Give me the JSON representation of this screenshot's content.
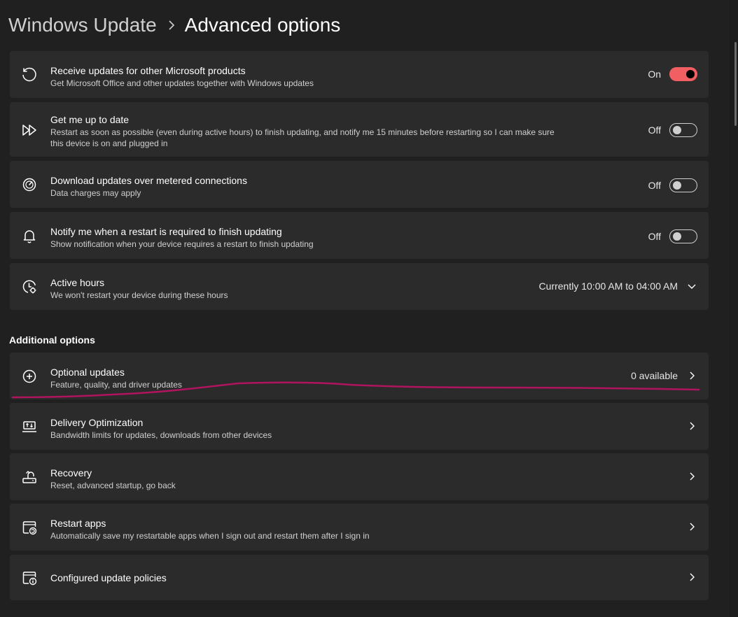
{
  "breadcrumb": {
    "parent": "Windows Update",
    "current": "Advanced options"
  },
  "settings": [
    {
      "title": "Receive updates for other Microsoft products",
      "description": "Get Microsoft Office and other updates together with Windows updates",
      "state_label": "On",
      "state": true,
      "icon": "refresh-icon"
    },
    {
      "title": "Get me up to date",
      "description": "Restart as soon as possible (even during active hours) to finish updating, and notify me 15 minutes before restarting so I can make sure this device is on and plugged in",
      "state_label": "Off",
      "state": false,
      "icon": "fast-forward-icon"
    },
    {
      "title": "Download updates over metered connections",
      "description": "Data charges may apply",
      "state_label": "Off",
      "state": false,
      "icon": "speedometer-icon"
    },
    {
      "title": "Notify me when a restart is required to finish updating",
      "description": "Show notification when your device requires a restart to finish updating",
      "state_label": "Off",
      "state": false,
      "icon": "bell-icon"
    }
  ],
  "active_hours": {
    "title": "Active hours",
    "description": "We won't restart your device during these hours",
    "value": "Currently 10:00 AM to 04:00 AM",
    "icon": "clock-icon"
  },
  "additional": {
    "heading": "Additional options",
    "items": [
      {
        "title": "Optional updates",
        "description": "Feature, quality, and driver updates",
        "value": "0 available",
        "icon": "plus-circle-icon"
      },
      {
        "title": "Delivery Optimization",
        "description": "Bandwidth limits for updates, downloads from other devices",
        "icon": "delivery-icon"
      },
      {
        "title": "Recovery",
        "description": "Reset, advanced startup, go back",
        "icon": "recovery-icon"
      },
      {
        "title": "Restart apps",
        "description": "Automatically save my restartable apps when I sign out and restart them after I sign in",
        "icon": "restart-apps-icon"
      },
      {
        "title": "Configured update policies",
        "icon": "policy-icon"
      }
    ]
  },
  "colors": {
    "background": "#202020",
    "card": "#2b2b2b",
    "accent": "#f25f62",
    "annotation": "#b0145e"
  }
}
